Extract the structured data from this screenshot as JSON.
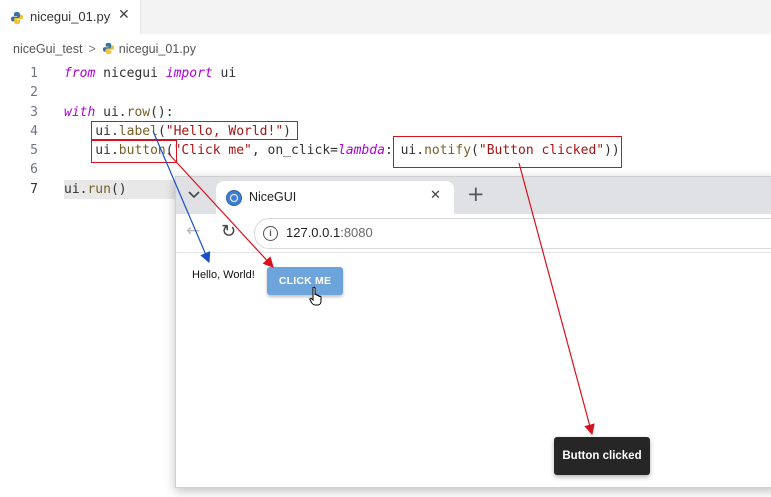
{
  "editor": {
    "tab": {
      "label": "nicegui_01.py",
      "close": "✕"
    },
    "breadcrumb": {
      "folder": "niceGui_test",
      "separator": ">",
      "file": "nicegui_01.py"
    },
    "lines": [
      {
        "n": "1",
        "tokens": [
          {
            "t": "from",
            "c": "kw"
          },
          {
            "t": " nicegui ",
            "c": "op"
          },
          {
            "t": "import",
            "c": "kw"
          },
          {
            "t": " ui",
            "c": "op"
          }
        ]
      },
      {
        "n": "2",
        "tokens": []
      },
      {
        "n": "3",
        "tokens": [
          {
            "t": "with",
            "c": "kw"
          },
          {
            "t": " ui.",
            "c": "op"
          },
          {
            "t": "row",
            "c": "fn"
          },
          {
            "t": "():",
            "c": "op"
          }
        ]
      },
      {
        "n": "4",
        "tokens": [
          {
            "t": "    ui.",
            "c": "op"
          },
          {
            "t": "label",
            "c": "fn"
          },
          {
            "t": "(",
            "c": "op"
          },
          {
            "t": "\"Hello, World!\"",
            "c": "str"
          },
          {
            "t": ")",
            "c": "op"
          }
        ]
      },
      {
        "n": "5",
        "tokens": [
          {
            "t": "    ui.",
            "c": "op"
          },
          {
            "t": "button",
            "c": "fn"
          },
          {
            "t": "(",
            "c": "op"
          },
          {
            "t": "\"Click me\"",
            "c": "str"
          },
          {
            "t": ", on_click=",
            "c": "op"
          },
          {
            "t": "lambda",
            "c": "kw"
          },
          {
            "t": ": ui.",
            "c": "op"
          },
          {
            "t": "notify",
            "c": "fn"
          },
          {
            "t": "(",
            "c": "op"
          },
          {
            "t": "\"Button clicked\"",
            "c": "str"
          },
          {
            "t": "))",
            "c": "op"
          }
        ]
      },
      {
        "n": "6",
        "tokens": []
      },
      {
        "n": "7",
        "tokens": [
          {
            "t": "ui.",
            "c": "op"
          },
          {
            "t": "run",
            "c": "fn"
          },
          {
            "t": "()",
            "c": "op"
          }
        ]
      }
    ]
  },
  "browser": {
    "tab_title": "NiceGUI",
    "tab_close": "✕",
    "new_tab": "+",
    "tab_list": "⌄",
    "back": "←",
    "reload": "↻",
    "info": "i",
    "url_host": "127.0.0.1",
    "url_port": ":8080",
    "page": {
      "label_text": "Hello, World!",
      "button_text": "CLICK ME",
      "notification": "Button clicked"
    }
  },
  "colors": {
    "annotation_blue": "#1b4fc9",
    "annotation_red": "#d9111c"
  }
}
